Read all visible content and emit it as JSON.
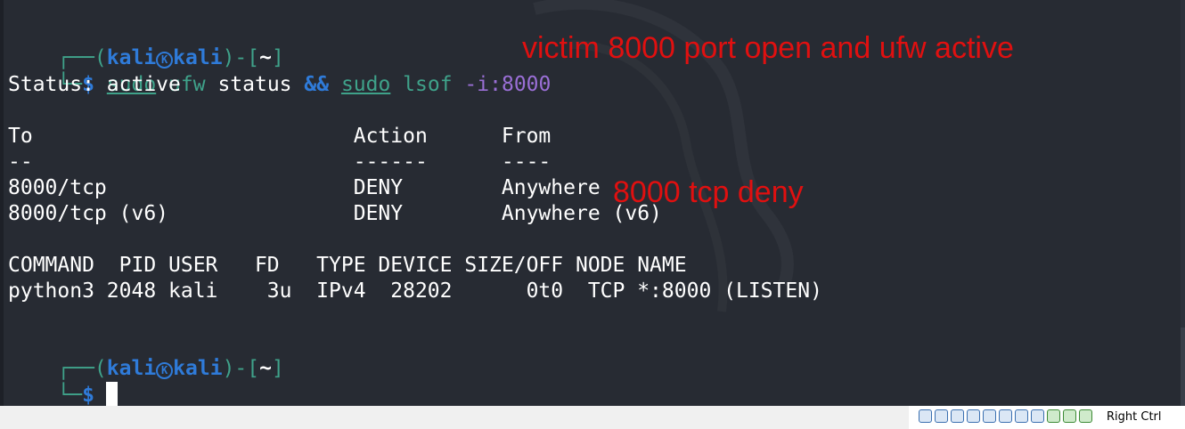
{
  "prompt": {
    "corner_top": "┌──(",
    "user": "kali",
    "host": "kali",
    "dir_open": ")-[",
    "dir": "~",
    "dir_close": "]",
    "corner_bottom": "└─",
    "symbol": "$"
  },
  "command": {
    "part1": "sudo",
    "part2": " ufw",
    "part3": " status ",
    "part4": "&&",
    "part5": "sudo",
    "part6": " lsof",
    "part7": " -i:8000"
  },
  "output": {
    "status": "Status: active",
    "header": "To                          Action      From",
    "divider": "--                          ------      ----",
    "rule1": "8000/tcp                    DENY        Anywhere",
    "rule2": "8000/tcp (v6)               DENY        Anywhere (v6)",
    "lsof_header": "COMMAND  PID USER   FD   TYPE DEVICE SIZE/OFF NODE NAME",
    "lsof_row": "python3 2048 kali    3u  IPv4  28202      0t0  TCP *:8000 (LISTEN)"
  },
  "annotations": {
    "top": "victim 8000 port open and ufw active",
    "middle": "8000 tcp deny"
  },
  "statusbar": {
    "right_ctrl": "Right Ctrl"
  },
  "colors": {
    "background": "#272b33",
    "prompt_blue": "#2f7bd9",
    "prompt_green": "#3fa28a",
    "annotation_red": "#e01010"
  }
}
